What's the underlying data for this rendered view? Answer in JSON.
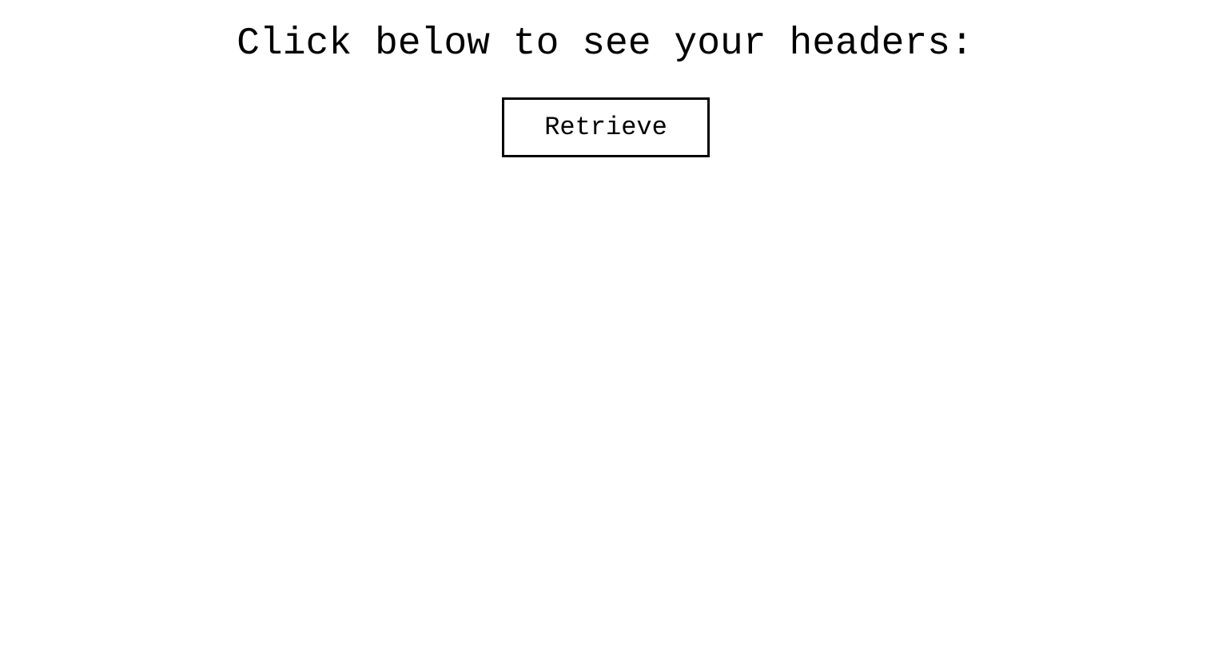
{
  "heading": {
    "text": "Click below to see your headers:"
  },
  "actions": {
    "retrieve_label": "Retrieve"
  },
  "colors": {
    "background": "#ffffff",
    "text": "#000000",
    "button_border": "#000000"
  }
}
